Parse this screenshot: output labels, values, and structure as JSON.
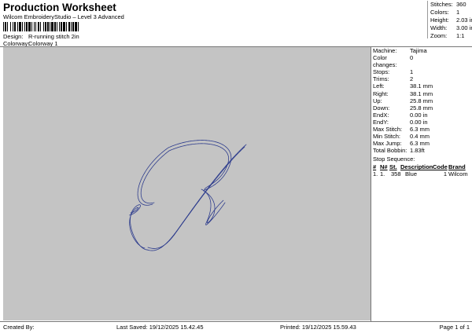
{
  "header": {
    "title": "Production Worksheet",
    "subtitle": "Wilcom EmbroideryStudio – Level 3 Advanced",
    "design_label": "Design:",
    "design_value": "R-running stitch 2in",
    "colorway_label": "Colorway:",
    "colorway_value": "Colorway 1"
  },
  "summary": [
    {
      "label": "Stitches:",
      "value": "360"
    },
    {
      "label": "Colors:",
      "value": "1"
    },
    {
      "label": "Height:",
      "value": "2.03 in"
    },
    {
      "label": "Width:",
      "value": "3.00 in"
    },
    {
      "label": "Zoom:",
      "value": "1:1"
    }
  ],
  "details": [
    {
      "label": "Machine:",
      "value": "Tajima"
    },
    {
      "label": "Color changes:",
      "value": "0"
    },
    {
      "label": "Stops:",
      "value": "1"
    },
    {
      "label": "Trims:",
      "value": "2"
    },
    {
      "label": "Left:",
      "value": "38.1 mm"
    },
    {
      "label": "Right:",
      "value": "38.1 mm"
    },
    {
      "label": "Up:",
      "value": "25.8 mm"
    },
    {
      "label": "Down:",
      "value": "25.8 mm"
    },
    {
      "label": "EndX:",
      "value": "0.00 in"
    },
    {
      "label": "EndY:",
      "value": "0.00 in"
    },
    {
      "label": "Max Stitch:",
      "value": "6.3 mm"
    },
    {
      "label": "Min Stitch:",
      "value": "0.4 mm"
    },
    {
      "label": "Max Jump:",
      "value": "6.3 mm"
    },
    {
      "label": "Total Bobbin:",
      "value": "1.83ft"
    }
  ],
  "stop_sequence": {
    "title": "Stop Sequence:",
    "columns": [
      "#",
      "N#",
      "St.",
      "Description",
      "Code",
      "Brand"
    ],
    "rows": [
      {
        "num": "1.",
        "n": "1.",
        "st": "358",
        "description": "Blue",
        "code": "1",
        "brand": "Wilcom"
      }
    ]
  },
  "colors": {
    "thread": "#1f2d78",
    "canvas": "#c4c4c4"
  },
  "footer": {
    "created_by": "Created By:",
    "last_saved": "Last Saved: 19/12/2025 15.42.45",
    "printed": "Printed: 19/12/2025 15.59.43",
    "page": "Page 1 of 1"
  }
}
